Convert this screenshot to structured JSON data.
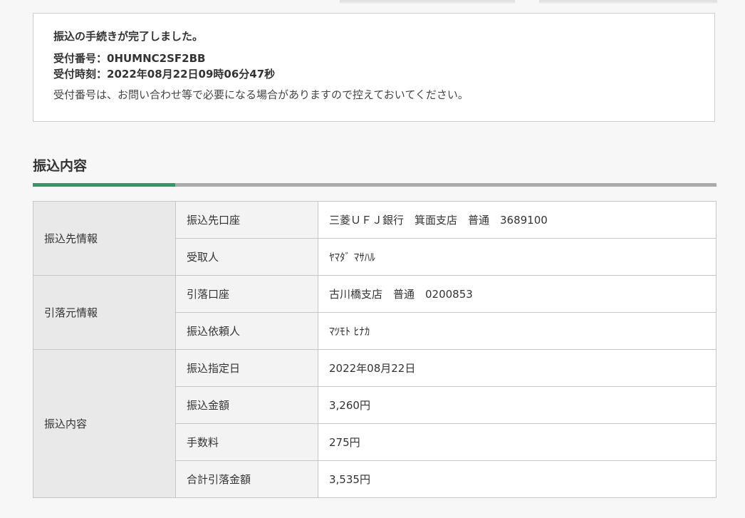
{
  "notice": {
    "headline": "振込の手続きが完了しました。",
    "reception_number_label": "受付番号：",
    "reception_number": "0HUMNC2SF2BB",
    "reception_time_label": "受付時刻：",
    "reception_time": "2022年08月22日09時06分47秒",
    "note": "受付番号は、お問い合わせ等で必要になる場合がありますので控えておいてください。"
  },
  "section": {
    "title": "振込内容"
  },
  "details": {
    "groups": [
      {
        "label": "振込先情報",
        "rows": [
          {
            "label": "振込先口座",
            "value": "三菱ＵＦＪ銀行　箕面支店　普通　3689100"
          },
          {
            "label": "受取人",
            "value": "ﾔﾏﾀﾞ ﾏｻﾊﾙ"
          }
        ]
      },
      {
        "label": "引落元情報",
        "rows": [
          {
            "label": "引落口座",
            "value": "古川橋支店　普通　0200853"
          },
          {
            "label": "振込依頼人",
            "value": "ﾏﾂﾓﾄ ﾋﾅｶ"
          }
        ]
      },
      {
        "label": "振込内容",
        "rows": [
          {
            "label": "振込指定日",
            "value": "2022年08月22日"
          },
          {
            "label": "振込金額",
            "value": "3,260円"
          },
          {
            "label": "手数料",
            "value": "275円"
          },
          {
            "label": "合計引落金額",
            "value": "3,535円"
          }
        ]
      }
    ]
  },
  "colors": {
    "accent": "#2e9b64",
    "rule": "#aaaaaa",
    "group_bg": "#e9e9e9",
    "label_bg": "#f3f3f3"
  }
}
